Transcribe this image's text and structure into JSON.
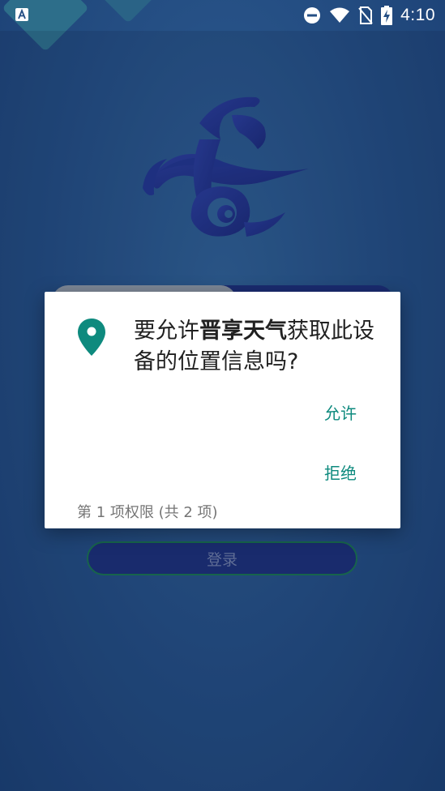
{
  "status_bar": {
    "time": "4:10",
    "icons": [
      "app-notification-icon",
      "do-not-disturb-icon",
      "wifi-icon",
      "no-sim-icon",
      "battery-charging-icon"
    ]
  },
  "login": {
    "button_label": "登录"
  },
  "permission_dialog": {
    "title_prefix": "要允许",
    "app_name": "晋享天气",
    "title_suffix": "获取此设备的位置信息吗?",
    "allow_label": "允许",
    "deny_label": "拒绝",
    "counter": "第 1 项权限 (共 2 项)",
    "icon": "location-pin-icon",
    "accent_color": "#0e8a7e"
  },
  "colors": {
    "background": "#254f84",
    "dialog_bg": "#ffffff",
    "action_text": "#0e8a7e"
  }
}
